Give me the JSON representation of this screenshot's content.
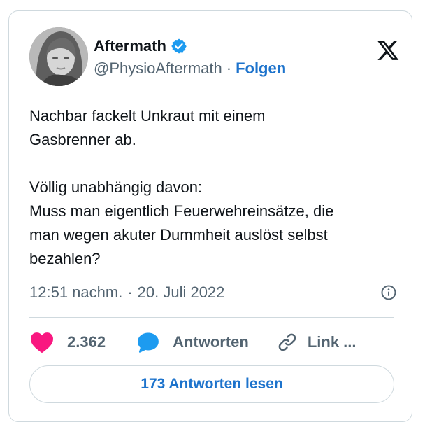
{
  "author": {
    "name": "Aftermath",
    "handle": "@PhysioAftermath",
    "separator": "·",
    "follow_label": "Folgen",
    "verified_color": "#1d9bf0"
  },
  "tweet": {
    "text": "Nachbar fackelt Unkraut mit einem\nGasbrenner ab.\n\nVöllig unabhängig davon:\nMuss man eigentlich Feuerwehreinsätze, die\nman wegen akuter Dummheit auslöst selbst\nbezahlen?",
    "time": "12:51 nachm.",
    "dot": "·",
    "date": "20. Juli 2022"
  },
  "actions": {
    "likes_count": "2.362",
    "reply_label": "Antworten",
    "link_label": "Link ..."
  },
  "read_replies_label": "173 Antworten lesen",
  "colors": {
    "accent": "#1d73cc",
    "like": "#f91880",
    "reply_icon": "#1d9bf0",
    "text": "#0f1419",
    "secondary": "#536471",
    "border": "#cfd9de"
  },
  "icons": [
    "verified-badge-icon",
    "x-logo-icon",
    "info-icon",
    "heart-icon",
    "reply-bubble-icon",
    "link-icon"
  ]
}
